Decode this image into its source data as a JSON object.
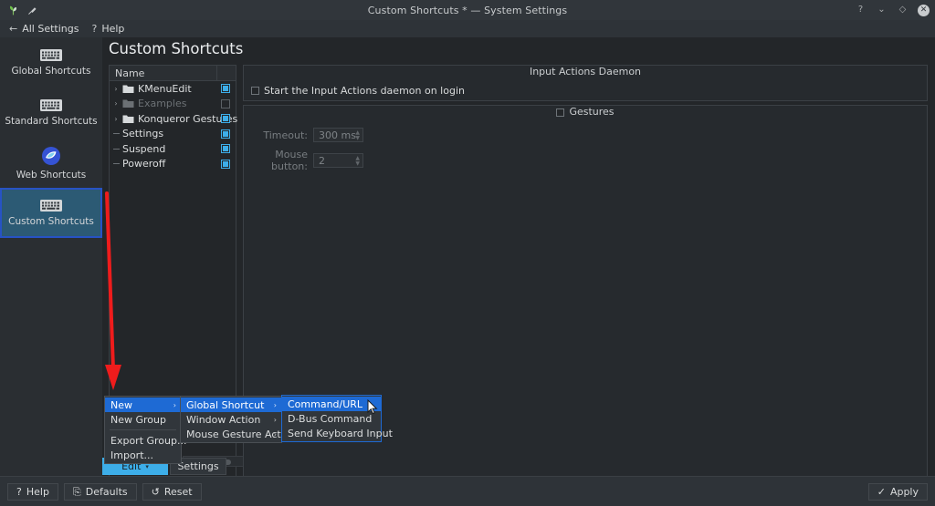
{
  "window": {
    "title": "Custom Shortcuts * — System Settings",
    "icons": [
      "plant-icon",
      "pin-icon"
    ],
    "controls": [
      {
        "name": "help-button",
        "glyph": "?"
      },
      {
        "name": "minimize-button",
        "glyph": "⌄"
      },
      {
        "name": "maximize-button",
        "glyph": "◇"
      },
      {
        "name": "close-button",
        "glyph": "✕"
      }
    ]
  },
  "toolbar": {
    "all_settings": "All Settings",
    "all_settings_icon": "←",
    "help": "Help",
    "help_icon": "?"
  },
  "sidebar": {
    "items": [
      {
        "label": "Global Shortcuts",
        "icon": "keyboard-icon",
        "selected": false
      },
      {
        "label": "Standard Shortcuts",
        "icon": "keyboard-icon",
        "selected": false
      },
      {
        "label": "Web Shortcuts",
        "icon": "web-globe-icon",
        "selected": false
      },
      {
        "label": "Custom Shortcuts",
        "icon": "keyboard-icon",
        "selected": true
      }
    ]
  },
  "page": {
    "title": "Custom Shortcuts"
  },
  "tree": {
    "column_header": "Name",
    "rows": [
      {
        "label": "KMenuEdit",
        "type": "group",
        "expandable": true,
        "checked": true,
        "dim": false
      },
      {
        "label": "Examples",
        "type": "group",
        "expandable": true,
        "checked": false,
        "dim": true
      },
      {
        "label": "Konqueror Gestures",
        "type": "group",
        "expandable": true,
        "checked": true,
        "dim": false
      },
      {
        "label": "Settings",
        "type": "item",
        "expandable": false,
        "checked": true,
        "dim": false
      },
      {
        "label": "Suspend",
        "type": "item",
        "expandable": false,
        "checked": true,
        "dim": false
      },
      {
        "label": "Poweroff",
        "type": "item",
        "expandable": false,
        "checked": true,
        "dim": false
      }
    ]
  },
  "tree_buttons": {
    "edit": "Edit",
    "edit_caret": "⌵",
    "settings": "Settings"
  },
  "daemon": {
    "group_title": "Input Actions Daemon",
    "checkbox_label": "Start the Input Actions daemon on login",
    "checked": false
  },
  "gestures": {
    "group_title": "Gestures",
    "checked": false,
    "timeout_label": "Timeout:",
    "timeout_value": "300 ms",
    "mouse_button_label": "Mouse button:",
    "mouse_button_value": "2"
  },
  "footer": {
    "help": "Help",
    "help_icon": "?",
    "defaults": "Defaults",
    "defaults_icon": "⎘",
    "reset": "Reset",
    "reset_icon": "↺",
    "apply": "Apply",
    "apply_icon": "✓"
  },
  "context_menu": {
    "level1": [
      {
        "label": "New",
        "submenu": true,
        "selected": true
      },
      {
        "label": "New Group",
        "submenu": false,
        "selected": false
      },
      {
        "separator": true
      },
      {
        "label": "Export Group...",
        "submenu": false,
        "selected": false
      },
      {
        "label": "Import...",
        "submenu": false,
        "selected": false
      }
    ],
    "level2": [
      {
        "label": "Global Shortcut",
        "submenu": true,
        "selected": true
      },
      {
        "label": "Window Action",
        "submenu": true,
        "selected": false
      },
      {
        "label": "Mouse Gesture Action",
        "submenu": true,
        "selected": false
      }
    ],
    "level3": [
      {
        "label": "Command/URL",
        "submenu": false,
        "selected": true
      },
      {
        "label": "D-Bus Command",
        "submenu": false,
        "selected": false
      },
      {
        "label": "Send Keyboard Input",
        "submenu": false,
        "selected": false
      }
    ],
    "submenu_arrow": "›"
  },
  "annotation": {
    "type": "red-arrow",
    "color": "#ef1c1c",
    "direction": "down"
  }
}
